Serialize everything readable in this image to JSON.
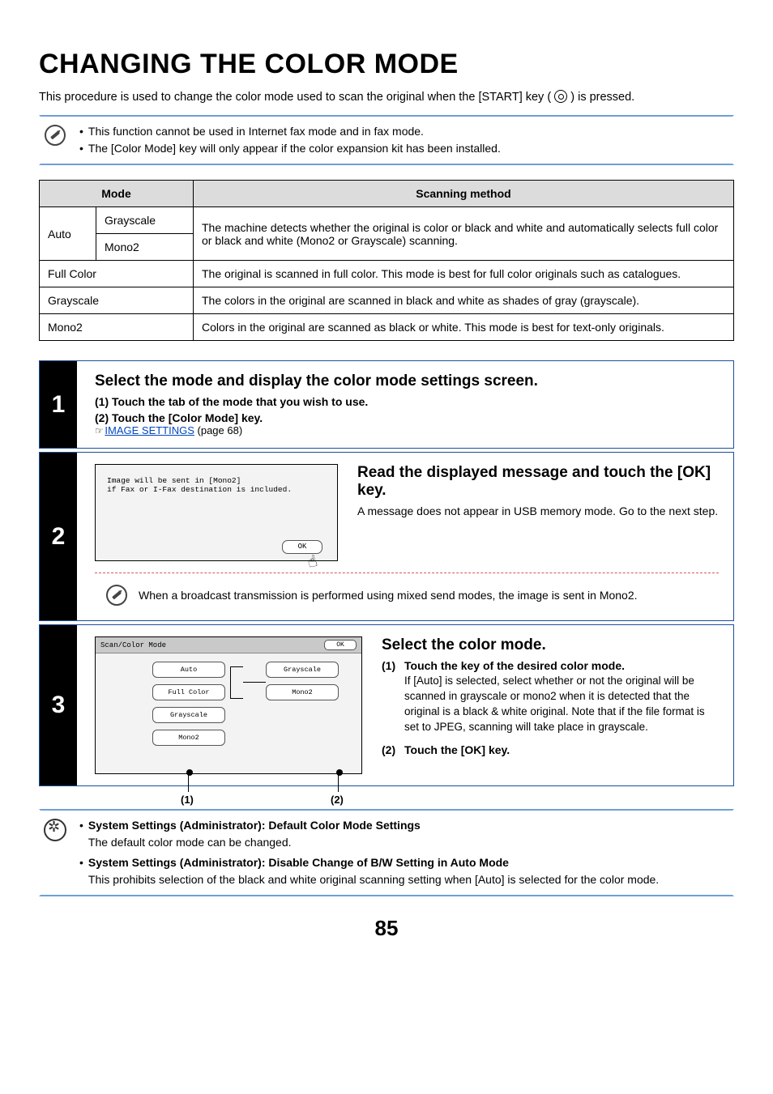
{
  "title": "CHANGING THE COLOR MODE",
  "intro_pre": "This procedure is used to change the color mode used to scan the original when the [START] key (",
  "intro_post": ") is pressed.",
  "note1": {
    "l1": "This function cannot be used in Internet fax mode and in fax mode.",
    "l2": "The [Color Mode] key will only appear if the color expansion kit has been installed."
  },
  "table": {
    "h_mode": "Mode",
    "h_scan": "Scanning method",
    "auto": "Auto",
    "grayscale": "Grayscale",
    "mono2": "Mono2",
    "fullcolor": "Full Color",
    "grayscale2": "Grayscale",
    "mono2_2": "Mono2",
    "r_auto": "The machine detects whether the original is color or black and white and automatically selects full color or black and white (Mono2 or Grayscale) scanning.",
    "r_full": "The original is scanned in full color. This mode is best for full color originals such as catalogues.",
    "r_gray": "The colors in the original are scanned in black and white as shades of gray (grayscale).",
    "r_mono": "Colors in the original are scanned as black or white. This mode is best for text-only originals."
  },
  "step1": {
    "num": "1",
    "title": "Select the mode and display the color mode settings screen.",
    "s1": "(1)  Touch the tab of the mode that you wish to use.",
    "s2": "(2)  Touch the [Color Mode] key.",
    "ptr": "☞",
    "link": "IMAGE SETTINGS",
    "link_after": " (page 68)"
  },
  "step2": {
    "num": "2",
    "panel_l1": "Image will be sent in [Mono2]",
    "panel_l2": "if Fax or I-Fax destination is included.",
    "ok": "OK",
    "title": "Read the displayed message and touch the [OK] key.",
    "desc": "A message does not appear in USB memory mode. Go to the next step.",
    "inner": "When a broadcast transmission is performed using mixed send modes, the image is sent in Mono2."
  },
  "step3": {
    "num": "3",
    "bar_title": "Scan/Color Mode",
    "ok": "OK",
    "btn_auto": "Auto",
    "btn_full": "Full Color",
    "btn_gray": "Grayscale",
    "btn_mono": "Mono2",
    "r_gray": "Grayscale",
    "r_mono": "Mono2",
    "lbl1": "(1)",
    "lbl2": "(2)",
    "title": "Select the color mode.",
    "s1": "Touch the key of the desired color mode.",
    "s1_desc": "If [Auto] is selected, select whether or not the original will be scanned in grayscale or mono2 when it is detected that the original is a black & white original. Note that if the file format is set to JPEG, scanning will take place in grayscale.",
    "s2": "Touch the [OK] key."
  },
  "admin": {
    "t1": "System Settings (Administrator): Default Color Mode Settings",
    "d1": "The default color mode can be changed.",
    "t2": "System Settings (Administrator): Disable Change of B/W Setting in Auto Mode",
    "d2": "This prohibits selection of the black and white original scanning setting when [Auto] is selected for the color mode."
  },
  "page": "85"
}
